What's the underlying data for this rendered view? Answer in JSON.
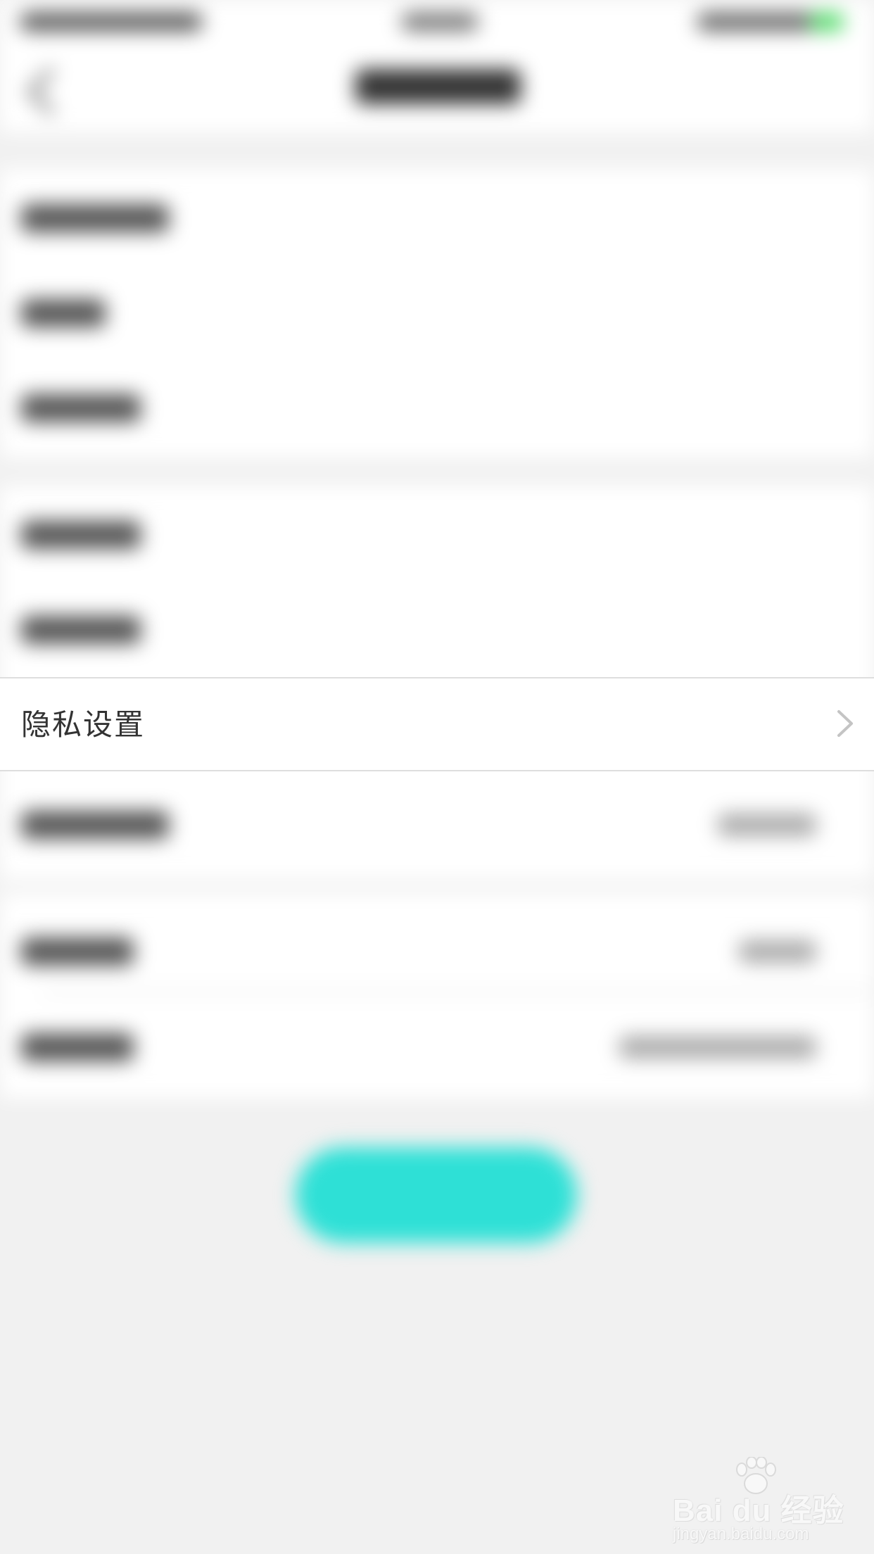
{
  "privacy_row": {
    "label": "隐私设置",
    "chevron_icon": "chevron-right-icon"
  },
  "watermark": {
    "brand": "Bai du 经验",
    "url": "jingyan.baidu.com"
  },
  "colors": {
    "page_background": "#f1f1f1",
    "row_background": "#ffffff",
    "label_text": "#333333",
    "accent_button": "#2ee0d6"
  }
}
